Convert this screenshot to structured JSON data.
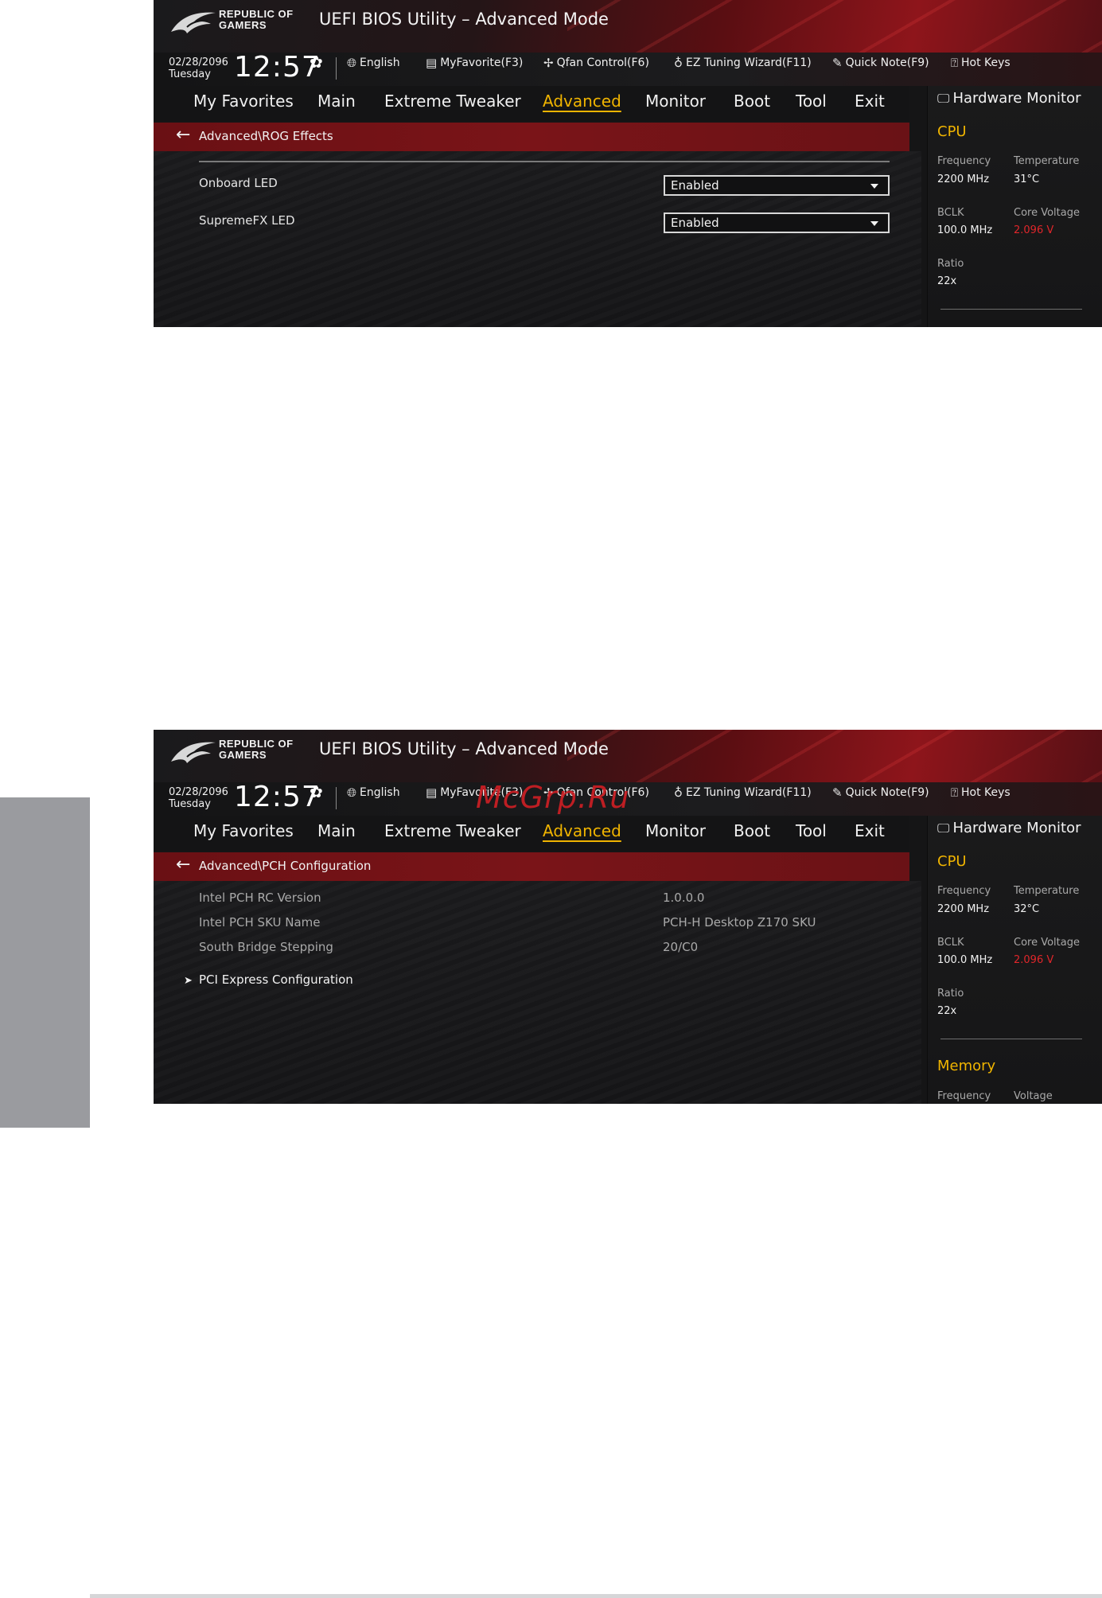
{
  "header": {
    "logo_line1": "REPUBLIC OF",
    "logo_line2": "GAMERS",
    "title": "UEFI BIOS Utility – Advanced Mode"
  },
  "status": {
    "date": "02/28/2096",
    "day": "Tuesday",
    "time": "12:57",
    "language": "English",
    "myfavorite": "MyFavorite(F3)",
    "qfan": "Qfan Control(F6)",
    "ez_tuning": "EZ Tuning Wizard(F11)",
    "quick_note": "Quick Note(F9)",
    "hot_keys": "Hot Keys"
  },
  "nav": {
    "items": [
      "My Favorites",
      "Main",
      "Extreme Tweaker",
      "Advanced",
      "Monitor",
      "Boot",
      "Tool",
      "Exit"
    ],
    "active": "Advanced"
  },
  "screen1": {
    "breadcrumb": "Advanced\\ROG Effects",
    "settings": [
      {
        "label": "Onboard LED",
        "value": "Enabled"
      },
      {
        "label": "SupremeFX LED",
        "value": "Enabled"
      }
    ],
    "hw": {
      "title": "Hardware Monitor",
      "cpu_title": "CPU",
      "frequency_label": "Frequency",
      "frequency": "2200 MHz",
      "temperature_label": "Temperature",
      "temperature": "31°C",
      "bclk_label": "BCLK",
      "bclk": "100.0 MHz",
      "core_voltage_label": "Core Voltage",
      "core_voltage": "2.096 V",
      "ratio_label": "Ratio",
      "ratio": "22x"
    }
  },
  "screen2": {
    "breadcrumb": "Advanced\\PCH Configuration",
    "info": [
      {
        "label": "Intel PCH RC Version",
        "value": "1.0.0.0"
      },
      {
        "label": "Intel PCH SKU Name",
        "value": "PCH-H Desktop Z170 SKU"
      },
      {
        "label": "South Bridge Stepping",
        "value": "20/C0"
      }
    ],
    "submenu": "PCI Express Configuration",
    "hw": {
      "title": "Hardware Monitor",
      "cpu_title": "CPU",
      "frequency_label": "Frequency",
      "frequency": "2200 MHz",
      "temperature_label": "Temperature",
      "temperature": "32°C",
      "bclk_label": "BCLK",
      "bclk": "100.0 MHz",
      "core_voltage_label": "Core Voltage",
      "core_voltage": "2.096 V",
      "ratio_label": "Ratio",
      "ratio": "22x",
      "memory_title": "Memory",
      "mem_frequency_label": "Frequency",
      "mem_voltage_label": "Voltage"
    }
  },
  "watermark": "McGrp.Ru",
  "colors": {
    "accent": "#f0b400",
    "breadcrumb": "#7a1418",
    "warning_voltage": "#e0262a"
  }
}
